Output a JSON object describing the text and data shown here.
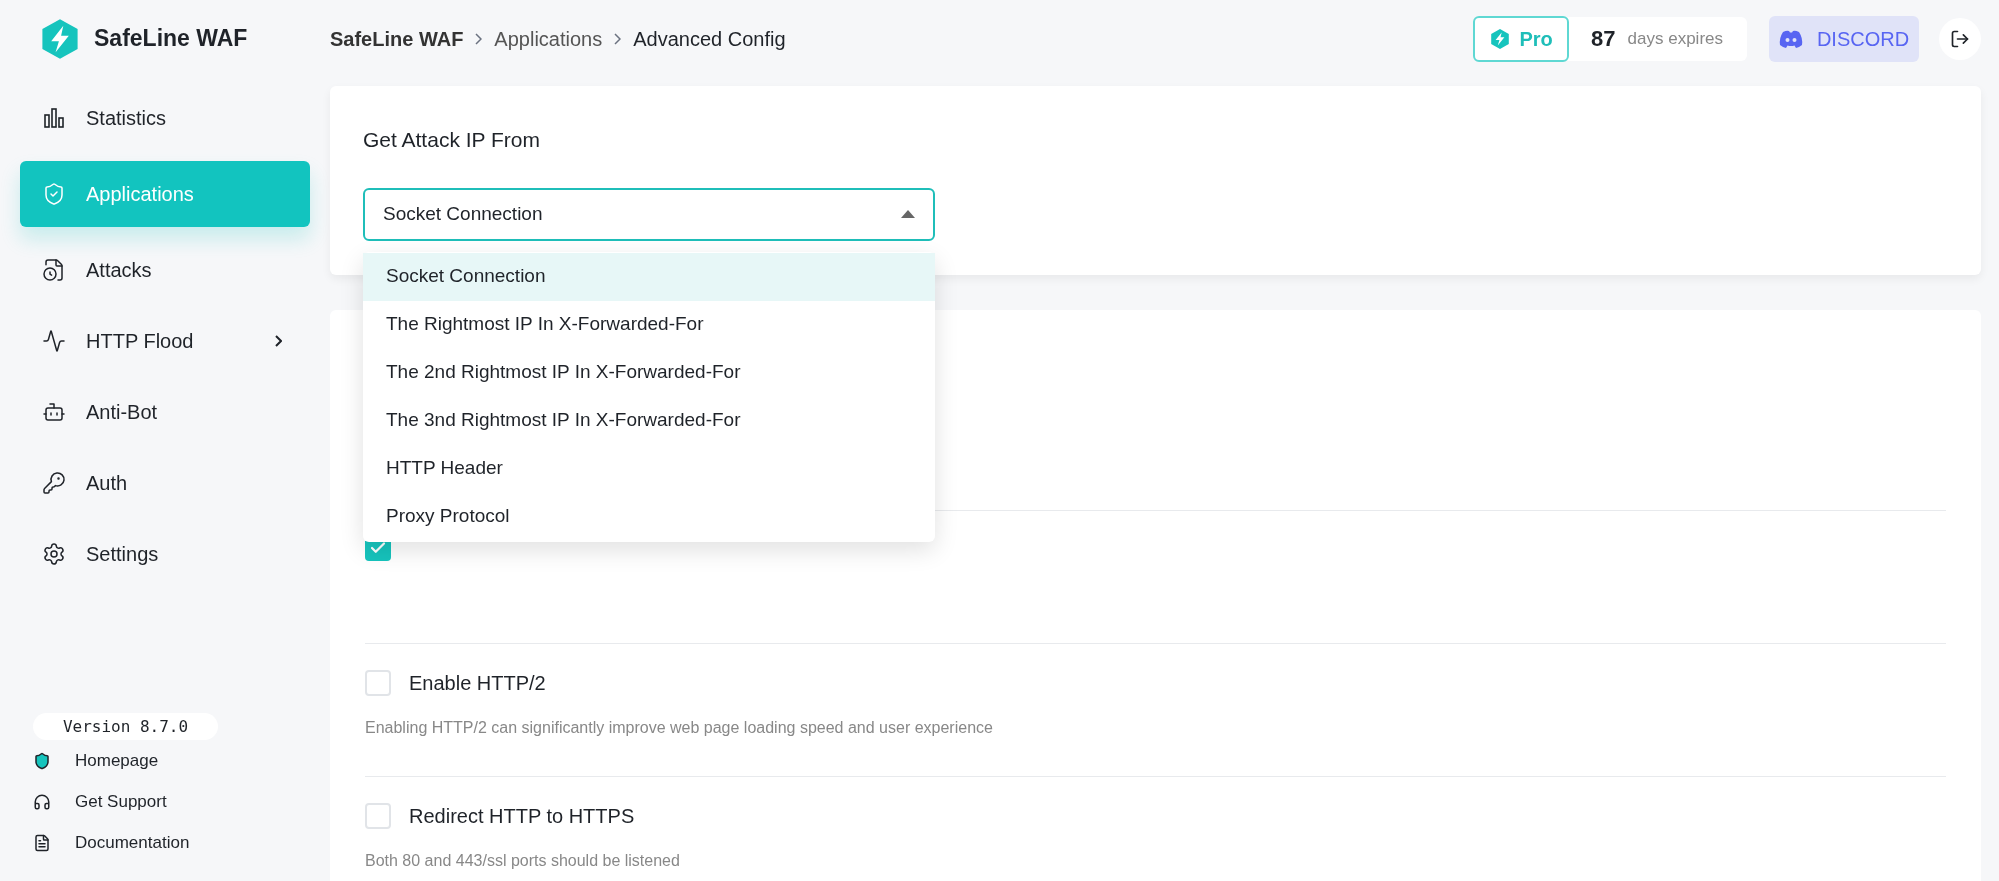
{
  "brand": {
    "name": "SafeLine WAF"
  },
  "breadcrumb": [
    {
      "label": "SafeLine WAF",
      "current": false
    },
    {
      "label": "Applications",
      "current": false
    },
    {
      "label": "Advanced Config",
      "current": true
    }
  ],
  "license": {
    "plan": "Pro",
    "days": "87",
    "days_label": "days expires"
  },
  "discord": {
    "label": "DISCORD"
  },
  "sidebar": {
    "items": [
      {
        "label": "Statistics",
        "selected": false,
        "has_submenu": false
      },
      {
        "label": "Applications",
        "selected": true,
        "has_submenu": false
      },
      {
        "label": "Attacks",
        "selected": false,
        "has_submenu": false
      },
      {
        "label": "HTTP Flood",
        "selected": false,
        "has_submenu": true
      },
      {
        "label": "Anti-Bot",
        "selected": false,
        "has_submenu": false
      },
      {
        "label": "Auth",
        "selected": false,
        "has_submenu": false
      },
      {
        "label": "Settings",
        "selected": false,
        "has_submenu": false
      }
    ],
    "version": "Version 8.7.0",
    "links": [
      {
        "label": "Homepage"
      },
      {
        "label": "Get Support"
      },
      {
        "label": "Documentation"
      }
    ]
  },
  "attack_ip": {
    "title": "Get Attack IP From",
    "value": "Socket Connection",
    "expanded": true,
    "options": [
      {
        "label": "Socket Connection",
        "selected": true
      },
      {
        "label": "The Rightmost IP In X-Forwarded-For",
        "selected": false
      },
      {
        "label": "The 2nd Rightmost IP In X-Forwarded-For",
        "selected": false
      },
      {
        "label": "The 3nd Rightmost IP In X-Forwarded-For",
        "selected": false
      },
      {
        "label": "HTTP Header",
        "selected": false
      },
      {
        "label": "Proxy Protocol",
        "selected": false
      }
    ]
  },
  "settings": [
    {
      "checked": true
    },
    {
      "label": "Enable HTTP/2",
      "checked": false,
      "description": "Enabling HTTP/2 can significantly improve web page loading speed and user experience"
    },
    {
      "label": "Redirect HTTP to HTTPS",
      "checked": false,
      "description": "Both 80 and 443/ssl ports should be listened"
    }
  ]
}
